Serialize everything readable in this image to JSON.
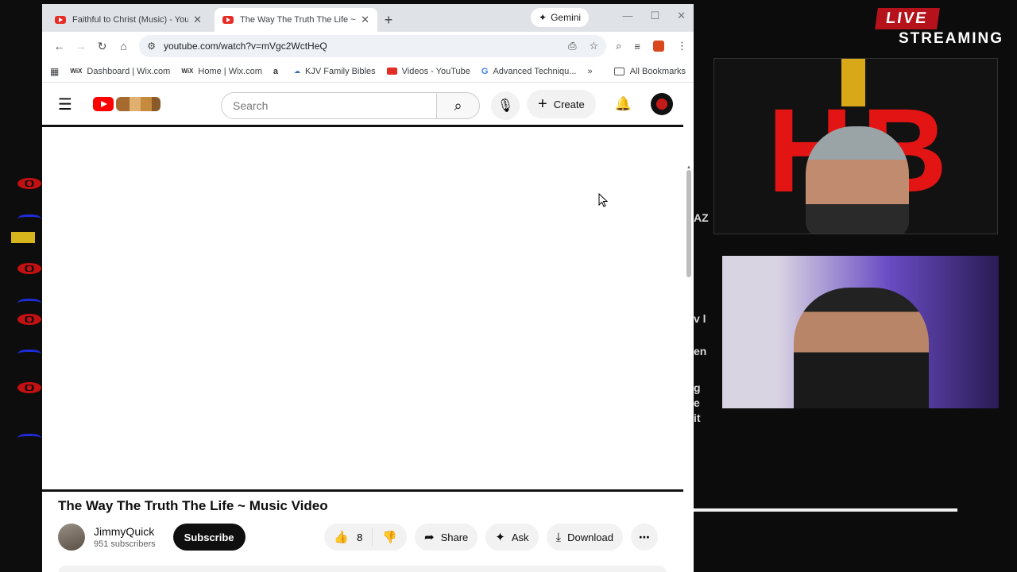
{
  "browser": {
    "tabs": [
      {
        "title": "Faithful to Christ (Music) - YouT",
        "active": false
      },
      {
        "title": "The Way The Truth The Life ~ M",
        "active": true
      }
    ],
    "gemini_label": "Gemini",
    "url": "youtube.com/watch?v=mVgc2WctHeQ",
    "bookmarks": [
      {
        "label": "Dashboard | Wix.com",
        "icon": "wix-icon"
      },
      {
        "label": "Home | Wix.com",
        "icon": "wix-icon"
      },
      {
        "label": "",
        "icon": "amazon-icon"
      },
      {
        "label": "KJV Family Bibles",
        "icon": "kjv-icon"
      },
      {
        "label": "Videos - YouTube",
        "icon": "youtube-icon"
      },
      {
        "label": "Advanced Techniqu...",
        "icon": "google-icon"
      }
    ],
    "all_bookmarks_label": "All Bookmarks"
  },
  "youtube": {
    "search_placeholder": "Search",
    "create_label": "Create",
    "video_title": "The Way The Truth The Life ~ Music Video",
    "channel_name": "JimmyQuick",
    "subscribers": "951 subscribers",
    "subscribe_label": "Subscribe",
    "like_count": "8",
    "share_label": "Share",
    "ask_label": "Ask",
    "download_label": "Download"
  },
  "overlay": {
    "live_label": "LIVE",
    "streaming_label": "STREAMING",
    "logo_text": "HB",
    "side_lines": [
      "v l",
      "en",
      "g",
      "e",
      "it"
    ],
    "side_top_text": "AZ"
  },
  "colors": {
    "youtube_red": "#ff0000",
    "live_red": "#b5121b"
  }
}
